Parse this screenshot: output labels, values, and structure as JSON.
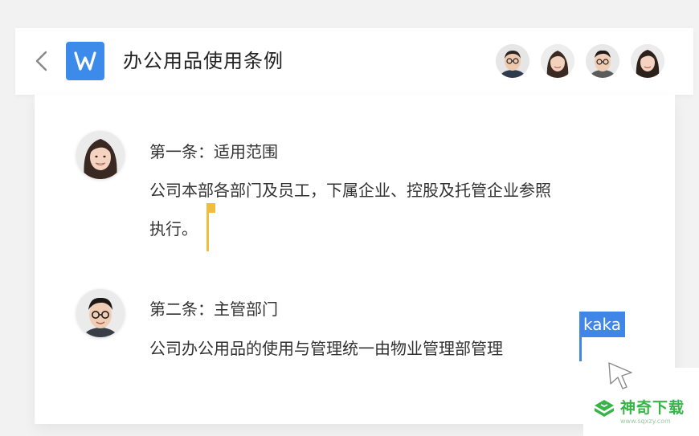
{
  "header": {
    "title": "办公用品使用条例",
    "logo_letter": "W",
    "collaborators": [
      "collaborator-1",
      "collaborator-2",
      "collaborator-3",
      "collaborator-4"
    ]
  },
  "document": {
    "section1": {
      "heading": "第一条：适用范围",
      "line1": "公司本部各部门及员工，下属企业、控股及托管企业参照",
      "line2": "执行。"
    },
    "section2": {
      "heading": "第二条：主管部门",
      "line1": "公司办公用品的使用与管理统一由物业管理部管理"
    }
  },
  "cursors": {
    "collaborator_label": "kaka",
    "colors": {
      "yellow": "#f2bc3f",
      "blue": "#3f86e8"
    }
  },
  "watermark": {
    "name": "神奇下载",
    "url": "www.sqxzy.com"
  },
  "colors": {
    "accent": "#3c8bea",
    "background": "#f2f2f3",
    "watermark_green": "#38b449"
  }
}
